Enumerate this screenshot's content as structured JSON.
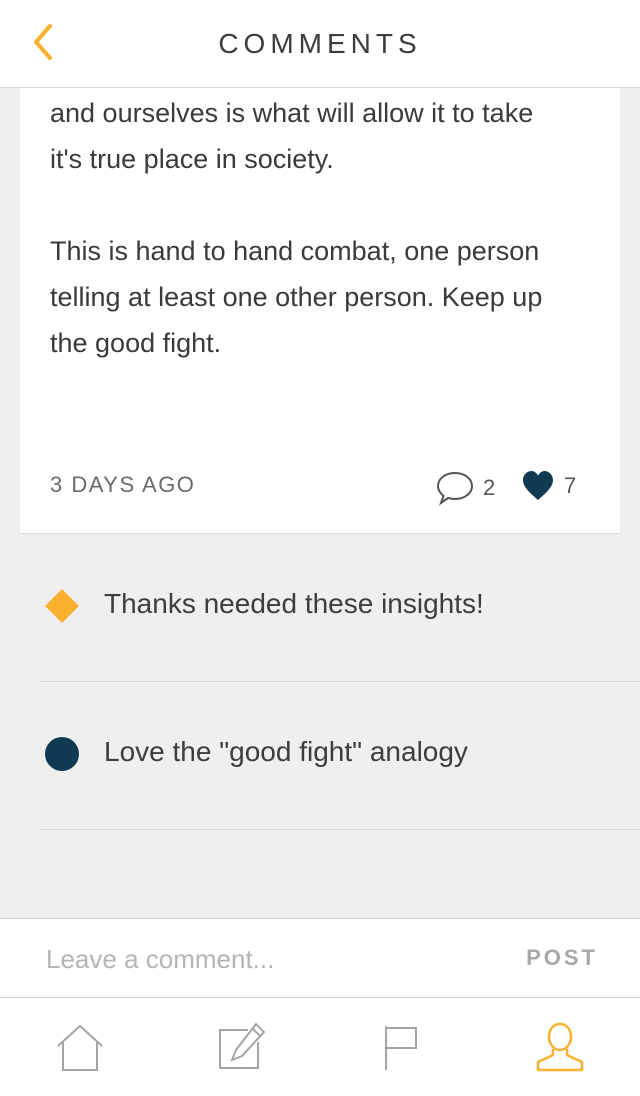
{
  "header": {
    "title": "COMMENTS",
    "back_icon": "chevron-left-icon"
  },
  "post": {
    "body": "and ourselves is what will allow it to take\nit's true place in society.\n\nThis is hand to hand combat, one person\ntelling at least one other person.  Keep up\nthe good fight.",
    "time_ago": "3 DAYS AGO",
    "comment_count": "2",
    "like_count": "7"
  },
  "comments": [
    {
      "text": "Thanks needed these insights!",
      "marker": "diamond",
      "color": "#fbb130"
    },
    {
      "text": "Love the \"good fight\" analogy",
      "marker": "circle",
      "color": "#103a52"
    }
  ],
  "composer": {
    "placeholder": "Leave a comment...",
    "post_label": "POST"
  },
  "tabbar": {
    "items": [
      {
        "icon": "home-icon",
        "active": false
      },
      {
        "icon": "compose-icon",
        "active": false
      },
      {
        "icon": "flag-icon",
        "active": false
      },
      {
        "icon": "profile-icon",
        "active": true
      }
    ]
  },
  "colors": {
    "accent": "#fbb130",
    "navy": "#103a52",
    "background": "#efefef"
  }
}
